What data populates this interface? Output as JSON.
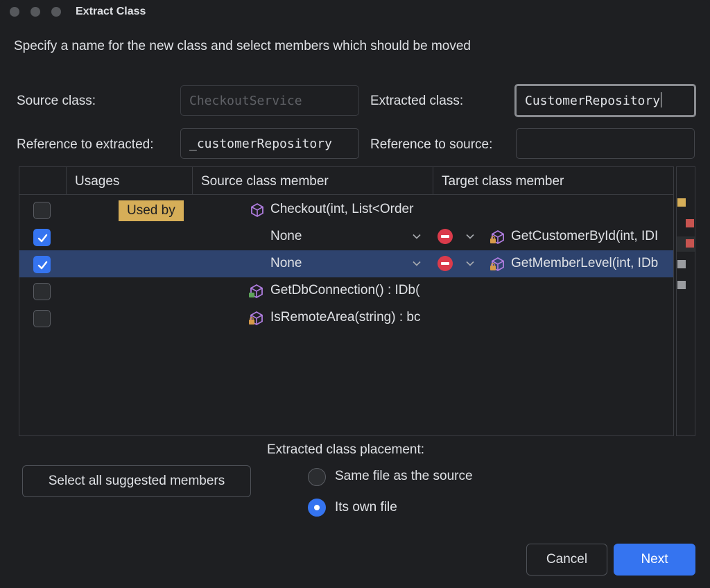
{
  "window": {
    "title": "Extract Class",
    "description": "Specify a name for the new class and select members which should be moved"
  },
  "form": {
    "source_class_label": "Source class:",
    "source_class_value": "CheckoutService",
    "extracted_class_label": "Extracted class:",
    "extracted_class_value": "CustomerRepository",
    "ref_extracted_label": "Reference to extracted:",
    "ref_extracted_value": "_customerRepository",
    "ref_source_label": "Reference to source:",
    "ref_source_value": ""
  },
  "table": {
    "columns": [
      "Usages",
      "Source class member",
      "Target class member"
    ],
    "rows": [
      {
        "checked": false,
        "usage": "Used by",
        "source": "Checkout(int, List<Order",
        "target": "",
        "source_icon": "method-icon"
      },
      {
        "checked": true,
        "usage": "",
        "source": "None",
        "target": "GetCustomerById(int, IDI",
        "target_icon": "private-method-icon"
      },
      {
        "checked": true,
        "usage": "",
        "source": "None",
        "target": "GetMemberLevel(int, IDb",
        "target_icon": "private-method-icon",
        "selected": true
      },
      {
        "checked": false,
        "usage": "",
        "source": "GetDbConnection() : IDb(",
        "target": "",
        "source_icon": "method-icon"
      },
      {
        "checked": false,
        "usage": "",
        "source": "IsRemoteArea(string) : bc",
        "target": "",
        "source_icon": "private-method-icon"
      }
    ]
  },
  "placement": {
    "label": "Extracted class placement:",
    "options": [
      "Same file as the source",
      "Its own file"
    ],
    "selected": "Its own file"
  },
  "buttons": {
    "select_all": "Select all suggested members",
    "cancel": "Cancel",
    "next": "Next"
  },
  "colors": {
    "accent": "#3574f0",
    "tag": "#d6ae58",
    "danger": "#db3b4b"
  }
}
